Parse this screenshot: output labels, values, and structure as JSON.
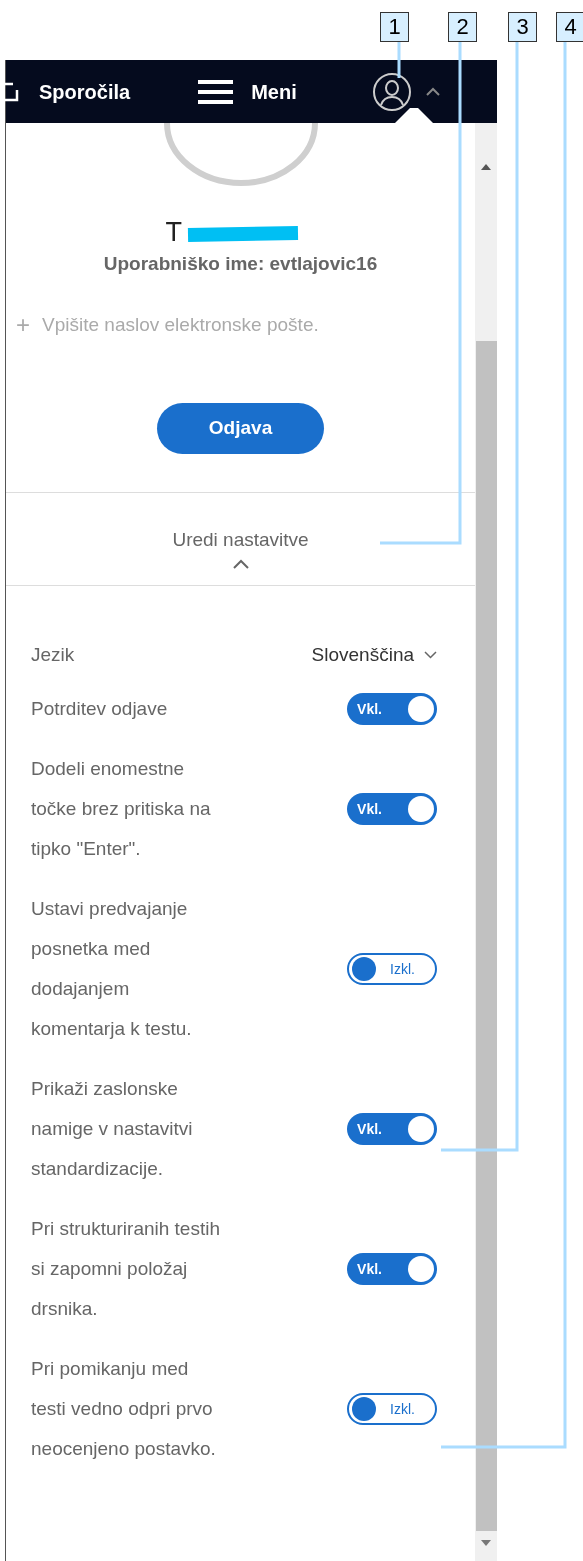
{
  "callouts": [
    "1",
    "2",
    "3",
    "4"
  ],
  "header": {
    "items": [
      {
        "kind": "messages",
        "label": "Sporočila"
      },
      {
        "kind": "menu",
        "label": "Meni"
      }
    ],
    "account_expanded": true
  },
  "profile": {
    "name": "T",
    "add_icon": "+",
    "username": "Uporabniško ime: evtlajovic16",
    "email_placeholder": "Vpišite naslov elektronske pošte.",
    "logout": "Odjava"
  },
  "settings_toggle": {
    "label": "Uredi nastavitve",
    "expanded": true
  },
  "language": {
    "label": "Jezik",
    "value": "Slovenščina"
  },
  "settings": [
    {
      "label": "Potrditev odjave",
      "on": true,
      "text": "Vkl."
    },
    {
      "label": "Dodeli enomestne točke brez pritiska na tipko \"Enter\".",
      "on": true,
      "text": "Vkl."
    },
    {
      "label": "Ustavi predvajanje posnetka med dodajanjem komentarja k testu.",
      "on": false,
      "text": "Izkl."
    },
    {
      "label": "Prikaži zaslonske namige v nastavitvi standardizacije.",
      "on": true,
      "text": "Vkl."
    },
    {
      "label": "Pri strukturiranih testih si zapomni položaj drsnika.",
      "on": true,
      "text": "Vkl."
    },
    {
      "label": "Pri pomikanju med testi vedno odpri prvo neocenjeno postavko.",
      "on": false,
      "text": "Izkl."
    }
  ]
}
